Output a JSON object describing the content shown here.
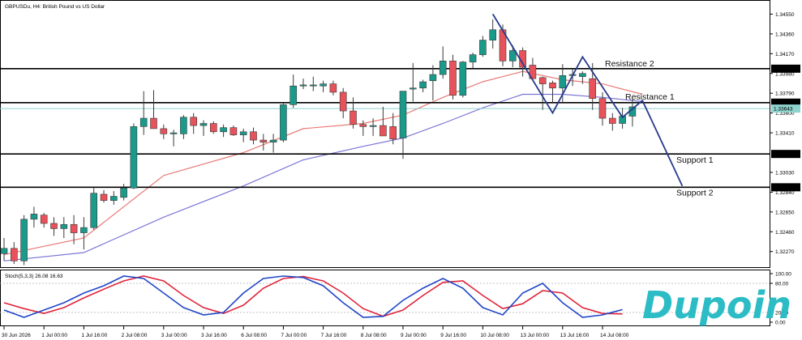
{
  "header": {
    "symbol_title": "GBPUSDu, H4:  British Pound vs US Dollar"
  },
  "brand": {
    "logo_text": "Dupoin",
    "logo_color": "#2bbcc6"
  },
  "colors": {
    "bull": "#1a9a8a",
    "bear": "#e8525a",
    "ma_fast": "#e77a76",
    "ma_slow": "#7b76d6",
    "current_price_line": "#8fd3cf",
    "stoch_main": "#2046c8",
    "stoch_signal": "#e0243a",
    "zigzag": "#263a8a"
  },
  "chart_data": {
    "type": "candlestick",
    "price_scale": {
      "ylim": [
        1.3212,
        1.3467
      ],
      "ticks": [
        "1.34550",
        "1.34360",
        "1.34170",
        "1.33980",
        "1.33790",
        "1.33600",
        "1.33410",
        "1.33030",
        "1.32840",
        "1.32650",
        "1.32460",
        "1.32270"
      ],
      "tick_values": [
        1.3455,
        1.3436,
        1.3417,
        1.3398,
        1.3379,
        1.336,
        1.3341,
        1.3303,
        1.3284,
        1.3265,
        1.3246,
        1.3227
      ]
    },
    "time_axis": {
      "labels": [
        "30 Jun 2026",
        "1 Jul 00:00",
        "1 Jul 16:00",
        "2 Jul 08:00",
        "3 Jul 00:00",
        "3 Jul 16:00",
        "6 Jul 08:00",
        "7 Jul 00:00",
        "7 Jul 16:00",
        "8 Jul 08:00",
        "9 Jul 00:00",
        "9 Jul 16:00",
        "10 Jul 08:00",
        "13 Jul 00:00",
        "13 Jul 16:00",
        "14 Jul 08:00"
      ],
      "label_bar_index": [
        0,
        4,
        8,
        12,
        16,
        20,
        24,
        28,
        32,
        36,
        40,
        44,
        48,
        52,
        56,
        60
      ]
    },
    "candles": [
      {
        "o": 1.3225,
        "h": 1.324,
        "l": 1.3218,
        "c": 1.323
      },
      {
        "o": 1.323,
        "h": 1.3236,
        "l": 1.3215,
        "c": 1.3218
      },
      {
        "o": 1.3218,
        "h": 1.3262,
        "l": 1.3214,
        "c": 1.3258
      },
      {
        "o": 1.3258,
        "h": 1.327,
        "l": 1.325,
        "c": 1.3263
      },
      {
        "o": 1.3262,
        "h": 1.3264,
        "l": 1.325,
        "c": 1.3254
      },
      {
        "o": 1.3254,
        "h": 1.326,
        "l": 1.3242,
        "c": 1.3249
      },
      {
        "o": 1.3249,
        "h": 1.326,
        "l": 1.324,
        "c": 1.3253
      },
      {
        "o": 1.3253,
        "h": 1.3262,
        "l": 1.3234,
        "c": 1.3245
      },
      {
        "o": 1.3245,
        "h": 1.326,
        "l": 1.3229,
        "c": 1.325
      },
      {
        "o": 1.325,
        "h": 1.3288,
        "l": 1.3248,
        "c": 1.3283
      },
      {
        "o": 1.3282,
        "h": 1.3286,
        "l": 1.3274,
        "c": 1.3276
      },
      {
        "o": 1.3276,
        "h": 1.3285,
        "l": 1.3272,
        "c": 1.328
      },
      {
        "o": 1.3279,
        "h": 1.3292,
        "l": 1.3276,
        "c": 1.3288
      },
      {
        "o": 1.3288,
        "h": 1.335,
        "l": 1.3287,
        "c": 1.3347
      },
      {
        "o": 1.3347,
        "h": 1.3381,
        "l": 1.3339,
        "c": 1.3355
      },
      {
        "o": 1.3355,
        "h": 1.3382,
        "l": 1.3345,
        "c": 1.3345
      },
      {
        "o": 1.3345,
        "h": 1.3349,
        "l": 1.3335,
        "c": 1.334
      },
      {
        "o": 1.334,
        "h": 1.3344,
        "l": 1.3328,
        "c": 1.3341
      },
      {
        "o": 1.334,
        "h": 1.3358,
        "l": 1.3335,
        "c": 1.3356
      },
      {
        "o": 1.3356,
        "h": 1.336,
        "l": 1.334,
        "c": 1.3348
      },
      {
        "o": 1.3348,
        "h": 1.3353,
        "l": 1.3338,
        "c": 1.335
      },
      {
        "o": 1.335,
        "h": 1.3352,
        "l": 1.334,
        "c": 1.3342
      },
      {
        "o": 1.3342,
        "h": 1.3349,
        "l": 1.3337,
        "c": 1.3346
      },
      {
        "o": 1.3346,
        "h": 1.3348,
        "l": 1.3338,
        "c": 1.3339
      },
      {
        "o": 1.3339,
        "h": 1.3345,
        "l": 1.3332,
        "c": 1.3342
      },
      {
        "o": 1.3342,
        "h": 1.3346,
        "l": 1.333,
        "c": 1.3334
      },
      {
        "o": 1.3334,
        "h": 1.334,
        "l": 1.3324,
        "c": 1.3332
      },
      {
        "o": 1.3332,
        "h": 1.334,
        "l": 1.3322,
        "c": 1.3334
      },
      {
        "o": 1.3334,
        "h": 1.337,
        "l": 1.3332,
        "c": 1.3368
      },
      {
        "o": 1.3368,
        "h": 1.3397,
        "l": 1.3365,
        "c": 1.3386
      },
      {
        "o": 1.3386,
        "h": 1.3393,
        "l": 1.3383,
        "c": 1.3387
      },
      {
        "o": 1.3386,
        "h": 1.3395,
        "l": 1.3381,
        "c": 1.3387
      },
      {
        "o": 1.3386,
        "h": 1.3391,
        "l": 1.338,
        "c": 1.3388
      },
      {
        "o": 1.3388,
        "h": 1.3391,
        "l": 1.3377,
        "c": 1.338
      },
      {
        "o": 1.338,
        "h": 1.3384,
        "l": 1.3355,
        "c": 1.3362
      },
      {
        "o": 1.3362,
        "h": 1.3375,
        "l": 1.3345,
        "c": 1.3349
      },
      {
        "o": 1.3349,
        "h": 1.3353,
        "l": 1.3338,
        "c": 1.3347
      },
      {
        "o": 1.3347,
        "h": 1.3355,
        "l": 1.3338,
        "c": 1.3348
      },
      {
        "o": 1.3348,
        "h": 1.3366,
        "l": 1.3343,
        "c": 1.3338
      },
      {
        "o": 1.3347,
        "h": 1.336,
        "l": 1.333,
        "c": 1.3335
      },
      {
        "o": 1.3336,
        "h": 1.3381,
        "l": 1.3316,
        "c": 1.3381
      },
      {
        "o": 1.3383,
        "h": 1.3408,
        "l": 1.3371,
        "c": 1.3384
      },
      {
        "o": 1.3384,
        "h": 1.3392,
        "l": 1.338,
        "c": 1.339
      },
      {
        "o": 1.3391,
        "h": 1.3406,
        "l": 1.3372,
        "c": 1.3397
      },
      {
        "o": 1.3397,
        "h": 1.3424,
        "l": 1.3393,
        "c": 1.341
      },
      {
        "o": 1.341,
        "h": 1.3416,
        "l": 1.3373,
        "c": 1.3377
      },
      {
        "o": 1.3377,
        "h": 1.341,
        "l": 1.3375,
        "c": 1.3409
      },
      {
        "o": 1.3409,
        "h": 1.3418,
        "l": 1.3403,
        "c": 1.3416
      },
      {
        "o": 1.3416,
        "h": 1.3434,
        "l": 1.3414,
        "c": 1.343
      },
      {
        "o": 1.343,
        "h": 1.345,
        "l": 1.3422,
        "c": 1.344
      },
      {
        "o": 1.344,
        "h": 1.3445,
        "l": 1.3405,
        "c": 1.341
      },
      {
        "o": 1.341,
        "h": 1.3425,
        "l": 1.3404,
        "c": 1.342
      },
      {
        "o": 1.342,
        "h": 1.3423,
        "l": 1.3395,
        "c": 1.3404
      },
      {
        "o": 1.3406,
        "h": 1.3413,
        "l": 1.3395,
        "c": 1.3393
      },
      {
        "o": 1.3394,
        "h": 1.3395,
        "l": 1.3363,
        "c": 1.3388
      },
      {
        "o": 1.3389,
        "h": 1.3391,
        "l": 1.337,
        "c": 1.3384
      },
      {
        "o": 1.3384,
        "h": 1.3407,
        "l": 1.337,
        "c": 1.3396
      },
      {
        "o": 1.3396,
        "h": 1.3402,
        "l": 1.3386,
        "c": 1.3397
      },
      {
        "o": 1.3395,
        "h": 1.34,
        "l": 1.3388,
        "c": 1.3398
      },
      {
        "o": 1.3393,
        "h": 1.3408,
        "l": 1.3363,
        "c": 1.3374
      },
      {
        "o": 1.3374,
        "h": 1.338,
        "l": 1.3348,
        "c": 1.3355
      },
      {
        "o": 1.3355,
        "h": 1.336,
        "l": 1.3343,
        "c": 1.335
      },
      {
        "o": 1.335,
        "h": 1.3365,
        "l": 1.3345,
        "c": 1.3357
      },
      {
        "o": 1.3357,
        "h": 1.3374,
        "l": 1.3347,
        "c": 1.3366
      }
    ],
    "ma_fast_points": [
      [
        0,
        1.3224
      ],
      [
        8,
        1.324
      ],
      [
        16,
        1.33
      ],
      [
        24,
        1.3322
      ],
      [
        30,
        1.3345
      ],
      [
        36,
        1.335
      ],
      [
        40,
        1.3358
      ],
      [
        44,
        1.3375
      ],
      [
        48,
        1.339
      ],
      [
        52,
        1.34
      ],
      [
        56,
        1.3392
      ],
      [
        60,
        1.3388
      ],
      [
        64,
        1.3378
      ]
    ],
    "ma_slow_points": [
      [
        0,
        1.3218
      ],
      [
        8,
        1.3226
      ],
      [
        16,
        1.326
      ],
      [
        24,
        1.329
      ],
      [
        30,
        1.3315
      ],
      [
        36,
        1.3328
      ],
      [
        40,
        1.3336
      ],
      [
        44,
        1.335
      ],
      [
        48,
        1.3365
      ],
      [
        52,
        1.3378
      ],
      [
        56,
        1.3378
      ],
      [
        60,
        1.3375
      ],
      [
        64,
        1.3371
      ]
    ],
    "levels": [
      {
        "name": "Resistance 2",
        "value": 1.34026,
        "label": "1.34026"
      },
      {
        "name": "Resistance 1",
        "value": 1.337,
        "label": "1.33700"
      },
      {
        "name": "Support 1",
        "value": 1.33207,
        "label": "1.33207"
      },
      {
        "name": "Support 2",
        "value": 1.32887,
        "label": "1.32887"
      }
    ],
    "current_price": {
      "value": 1.33643,
      "label": "1.33643"
    },
    "zigzag_points": [
      [
        49,
        1.3455
      ],
      [
        55,
        1.336
      ],
      [
        58,
        1.3414
      ],
      [
        62,
        1.3356
      ],
      [
        64,
        1.3372
      ],
      [
        68,
        1.329
      ]
    ],
    "stochastic": {
      "title": "Stoch(5,3,3) 26.08 16.63",
      "scale_labels": [
        "100.00",
        "80.00",
        "20.00",
        "0.00"
      ],
      "scale_values": [
        100,
        80,
        20,
        0
      ],
      "main_points": [
        [
          0,
          25
        ],
        [
          2,
          10
        ],
        [
          4,
          25
        ],
        [
          6,
          40
        ],
        [
          8,
          60
        ],
        [
          10,
          75
        ],
        [
          12,
          95
        ],
        [
          14,
          90
        ],
        [
          16,
          60
        ],
        [
          18,
          30
        ],
        [
          20,
          15
        ],
        [
          22,
          20
        ],
        [
          24,
          60
        ],
        [
          26,
          90
        ],
        [
          28,
          95
        ],
        [
          30,
          92
        ],
        [
          32,
          75
        ],
        [
          34,
          40
        ],
        [
          36,
          10
        ],
        [
          38,
          12
        ],
        [
          40,
          45
        ],
        [
          42,
          70
        ],
        [
          44,
          90
        ],
        [
          46,
          70
        ],
        [
          48,
          30
        ],
        [
          50,
          15
        ],
        [
          52,
          60
        ],
        [
          54,
          80
        ],
        [
          56,
          40
        ],
        [
          58,
          10
        ],
        [
          60,
          15
        ],
        [
          62,
          26
        ]
      ],
      "signal_points": [
        [
          0,
          40
        ],
        [
          2,
          28
        ],
        [
          4,
          18
        ],
        [
          6,
          30
        ],
        [
          8,
          50
        ],
        [
          10,
          68
        ],
        [
          12,
          85
        ],
        [
          14,
          95
        ],
        [
          16,
          85
        ],
        [
          18,
          55
        ],
        [
          20,
          30
        ],
        [
          22,
          18
        ],
        [
          24,
          35
        ],
        [
          26,
          70
        ],
        [
          28,
          90
        ],
        [
          30,
          94
        ],
        [
          32,
          85
        ],
        [
          34,
          60
        ],
        [
          36,
          28
        ],
        [
          38,
          12
        ],
        [
          40,
          25
        ],
        [
          42,
          55
        ],
        [
          44,
          82
        ],
        [
          46,
          85
        ],
        [
          48,
          55
        ],
        [
          50,
          28
        ],
        [
          52,
          38
        ],
        [
          54,
          65
        ],
        [
          56,
          60
        ],
        [
          58,
          30
        ],
        [
          60,
          18
        ],
        [
          62,
          17
        ]
      ]
    }
  }
}
